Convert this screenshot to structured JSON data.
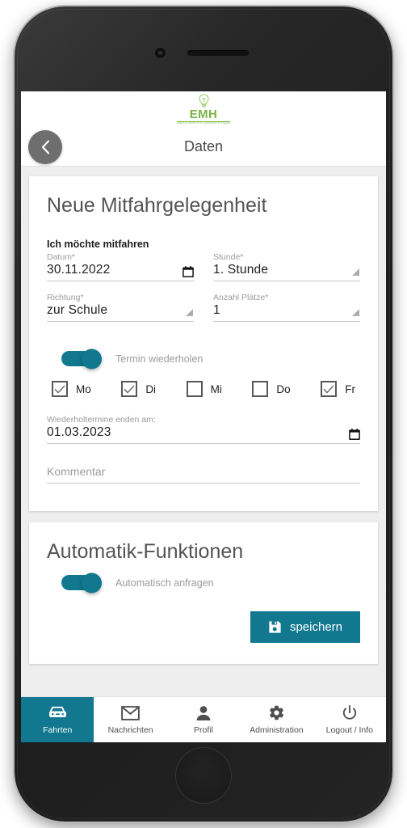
{
  "app": {
    "logo": {
      "icon": "lightbulb-icon",
      "wordmark": "EMH",
      "tagline": "ENERGIE MOBILITÄT HANDWERKSKAMMER",
      "color": "#79b443"
    },
    "accent_color": "#12788f",
    "header": {
      "title": "Daten",
      "back_icon": "chevron-left-icon"
    }
  },
  "ride_card": {
    "title": "Neue Mitfahrgelegenheit",
    "section_label": "Ich möchte mitfahren",
    "fields": [
      {
        "label": "Datum*",
        "value": "30.11.2022",
        "control": "date"
      },
      {
        "label": "Stunde*",
        "value": "1. Stunde",
        "control": "select"
      },
      {
        "label": "Richtung*",
        "value": "zur Schule",
        "control": "select"
      },
      {
        "label": "Anzahl Plätze*",
        "value": "1",
        "control": "select"
      }
    ],
    "repeat_toggle": {
      "label": "Termin wiederholen",
      "on": true
    },
    "weekdays": [
      {
        "label": "Mo",
        "checked": true
      },
      {
        "label": "Di",
        "checked": true
      },
      {
        "label": "Mi",
        "checked": false
      },
      {
        "label": "Do",
        "checked": false
      },
      {
        "label": "Fr",
        "checked": true
      }
    ],
    "end_date": {
      "label": "Wiederholtermine enden am:",
      "value": "01.03.2023",
      "control": "date"
    },
    "comment": {
      "placeholder": "Kommentar",
      "value": ""
    }
  },
  "automatik_card": {
    "title": "Automatik-Funktionen",
    "auto_toggle": {
      "label": "Automatisch anfragen",
      "on": true
    },
    "save_button": {
      "label": "speichern",
      "icon": "save-floppy-icon"
    }
  },
  "bottom_nav": {
    "items": [
      {
        "label": "Fahrten",
        "icon": "car-icon",
        "active": true
      },
      {
        "label": "Nachrichten",
        "icon": "mail-icon",
        "active": false
      },
      {
        "label": "Profil",
        "icon": "person-icon",
        "active": false
      },
      {
        "label": "Administration",
        "icon": "gear-icon",
        "active": false
      },
      {
        "label": "Logout / Info",
        "icon": "power-icon",
        "active": false
      }
    ]
  }
}
